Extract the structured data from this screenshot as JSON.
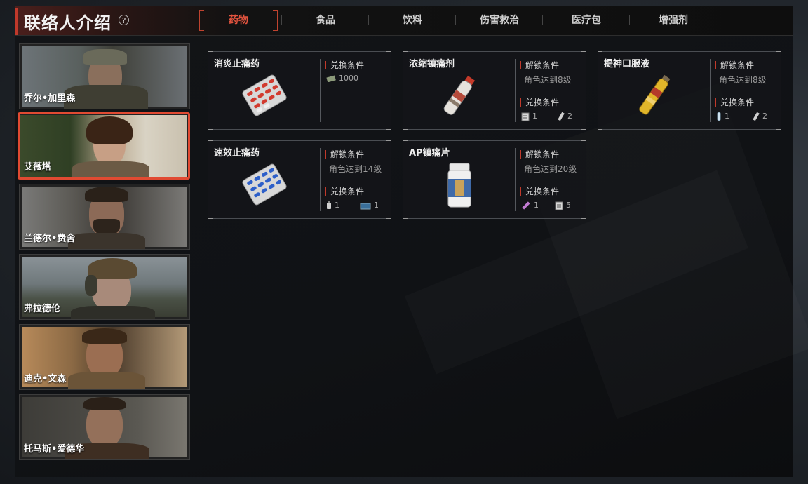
{
  "header": {
    "title": "联络人介绍",
    "help_icon": "?",
    "tabs": [
      {
        "label": "药物",
        "active": true
      },
      {
        "label": "食品",
        "active": false
      },
      {
        "label": "饮料",
        "active": false
      },
      {
        "label": "伤害救治",
        "active": false
      },
      {
        "label": "医疗包",
        "active": false
      },
      {
        "label": "增强剂",
        "active": false
      }
    ]
  },
  "contacts": [
    {
      "name": "乔尔•加里森",
      "selected": false
    },
    {
      "name": "艾薇塔",
      "selected": true
    },
    {
      "name": "兰德尔•费舍",
      "selected": false
    },
    {
      "name": "弗拉德伦",
      "selected": false
    },
    {
      "name": "迪克•文森",
      "selected": false
    },
    {
      "name": "托马斯•爱德华",
      "selected": false
    }
  ],
  "items": [
    {
      "name": "消炎止痛药",
      "icon": "blister-pack-red-icon",
      "exchange_label": "兑换条件",
      "cost": [
        {
          "icon": "cash-icon",
          "amount": "1000"
        }
      ]
    },
    {
      "name": "浓缩镇痛剂",
      "icon": "spray-can-icon",
      "unlock_label": "解锁条件",
      "unlock_text": "角色达到8级",
      "exchange_label": "兑换条件",
      "cost": [
        {
          "icon": "notebook-icon",
          "amount": "1"
        },
        {
          "icon": "vial-icon",
          "amount": "2"
        }
      ]
    },
    {
      "name": "提神口服液",
      "icon": "yellow-tube-icon",
      "unlock_label": "解锁条件",
      "unlock_text": "角色达到8级",
      "exchange_label": "兑换条件",
      "cost": [
        {
          "icon": "test-tube-icon",
          "amount": "1"
        },
        {
          "icon": "vial-icon",
          "amount": "2"
        }
      ]
    },
    {
      "name": "速效止痛药",
      "icon": "blister-pack-blue-icon",
      "unlock_label": "解锁条件",
      "unlock_text": "角色达到14级",
      "exchange_label": "兑换条件",
      "cost": [
        {
          "icon": "bottle-icon",
          "amount": "1"
        },
        {
          "icon": "blue-box-icon",
          "amount": "1"
        }
      ]
    },
    {
      "name": "AP镇痛片",
      "icon": "pill-bottle-icon",
      "unlock_label": "解锁条件",
      "unlock_text": "角色达到20级",
      "exchange_label": "兑换条件",
      "cost": [
        {
          "icon": "syringe-icon",
          "amount": "1"
        },
        {
          "icon": "notebook-icon",
          "amount": "5"
        }
      ]
    }
  ],
  "colors": {
    "accent": "#e0533e",
    "selected_border": "#e14a32"
  }
}
